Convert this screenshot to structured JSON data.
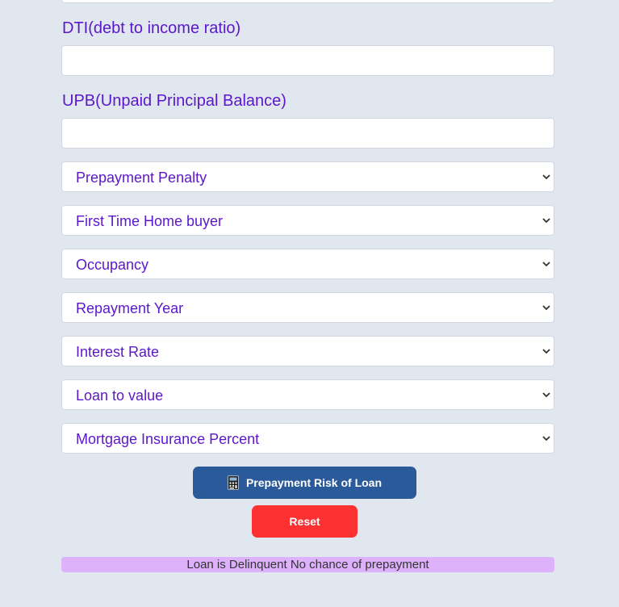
{
  "form": {
    "dti_label": "DTI(debt to income ratio)",
    "dti_value": "",
    "upb_label": "UPB(Unpaid Principal Balance)",
    "upb_value": "",
    "selects": [
      {
        "name": "prepayment-penalty-select",
        "value": "Prepayment Penalty"
      },
      {
        "name": "first-time-home-buyer-select",
        "value": "First Time Home buyer"
      },
      {
        "name": "occupancy-select",
        "value": "Occupancy"
      },
      {
        "name": "repayment-year-select",
        "value": "Repayment Year"
      },
      {
        "name": "interest-rate-select",
        "value": "Interest Rate"
      },
      {
        "name": "loan-to-value-select",
        "value": "Loan to value"
      },
      {
        "name": "mortgage-insurance-percent-select",
        "value": "Mortgage Insurance Percent"
      }
    ]
  },
  "actions": {
    "predict_label": "Prepayment Risk of Loan",
    "predict_icon": "calculator-icon",
    "reset_label": "Reset"
  },
  "result": {
    "message": "Loan is Delinquent No chance of prepayment"
  },
  "colors": {
    "background": "#e0e7ef",
    "label": "#5b17cc",
    "primary_button": "#2b5a9b",
    "reset_button": "#fd3132",
    "result_banner": "#deb1fb"
  }
}
